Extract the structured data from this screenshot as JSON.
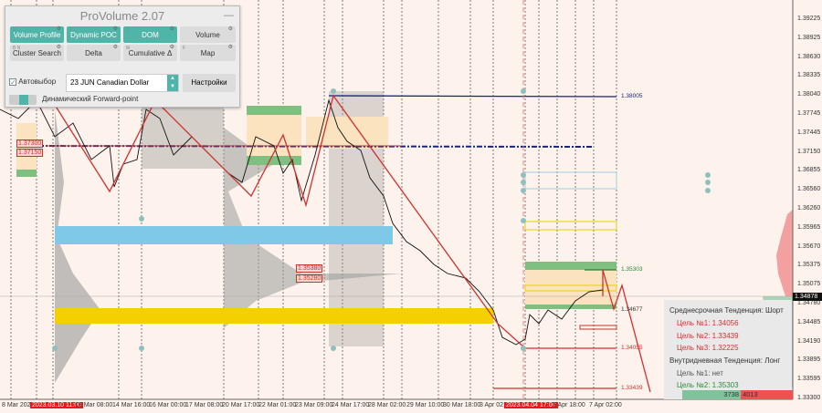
{
  "panel": {
    "title": "ProVolume 2.07",
    "buttons": [
      {
        "key": "V",
        "label": "Volume Profile",
        "active": true
      },
      {
        "key": "P",
        "label": "Dynamic POC",
        "active": true
      },
      {
        "key": "D",
        "label": "DOM",
        "active": true
      },
      {
        "key": "",
        "label": "Volume",
        "active": false
      },
      {
        "key": "B  N",
        "label": "Cluster Search",
        "active": false
      },
      {
        "key": "",
        "label": "Delta",
        "active": false
      },
      {
        "key": "M",
        "label": "Cumulative Δ",
        "active": false
      },
      {
        "key": "F",
        "label": "Map",
        "active": false
      }
    ],
    "auto_select_label": "Автовыбор",
    "auto_select_checked": true,
    "instrument": "23 JUN Canadian Dollar",
    "settings_label": "Настройки",
    "forward_point_label": "Динамический Forward-point"
  },
  "price_axis": [
    "1.39225",
    "1.38925",
    "1.38630",
    "1.38335",
    "1.38040",
    "1.37745",
    "1.37445",
    "1.37150",
    "1.36855",
    "1.36560",
    "1.36260",
    "1.35965",
    "1.35670",
    "1.35375",
    "1.35075",
    "1.34780",
    "1.34485",
    "1.34190",
    "1.33895",
    "1.33595",
    "1.33300"
  ],
  "current_price": "1.34878",
  "time_axis": [
    "8 Mar 2023",
    "2023.03.10 11:00",
    "13 Mar 08:00",
    "14 Mar 16:00",
    "16 Mar 00:00",
    "17 Mar 08:00",
    "20 Mar 17:00",
    "22 Mar 01:00",
    "23 Mar 09:00",
    "24 Mar 17:00",
    "28 Mar 02:00",
    "29 Mar 10:00",
    "30 Mar 18:00",
    "3 Apr 02:",
    "2023.04.04 17:00",
    "5 Apr 18:00",
    "7 Apr 02:00"
  ],
  "levels": {
    "l1": "1.38005",
    "l2": "1.35303",
    "l3": "1.34677",
    "l4": "1.34055",
    "l5": "1.33439"
  },
  "boxes": {
    "b1": "1.37300",
    "b2": "1.37150",
    "b3": "1.35380",
    "b4": "1.35280"
  },
  "info": {
    "mid_trend": "Среднесрочная Тенденция: Шорт",
    "mid_targets": [
      "Цель №1: 1.34056",
      "Цель №2: 1.33439",
      "Цель №3: 1.32225"
    ],
    "intraday_trend": "Внутридневная Тенденция: Лонг",
    "intraday_targets": [
      "Цель №1: нет",
      "Цель №2: 1.35303"
    ],
    "buy_volume": "3738",
    "sell_volume": "4013"
  },
  "colors": {
    "buy": "#7fc29b",
    "sell": "#f05050",
    "accent": "#4fb5a8"
  }
}
